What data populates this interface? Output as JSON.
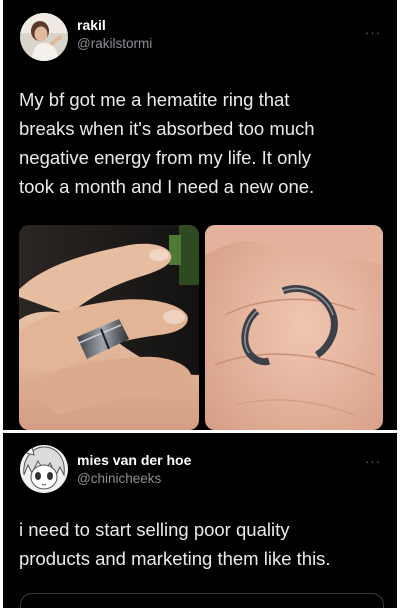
{
  "tweets": [
    {
      "display_name": "rakil",
      "handle": "@rakilstormi",
      "more_label": "···",
      "avatar_icon": "user-photo-avatar",
      "lines": [
        "My bf got me a hematite ring that",
        "breaks when it's absorbed too much",
        "negative energy from my life. It only",
        "took a month and I need a new one."
      ],
      "media": [
        "hand-with-ring-photo",
        "broken-ring-in-palm-photo"
      ]
    },
    {
      "display_name": "mies van der hoe",
      "handle": "@chinicheeks",
      "more_label": "···",
      "avatar_icon": "anime-avatar",
      "lines": [
        "i need to start selling poor quality",
        "products and marketing them like this."
      ]
    }
  ],
  "colors": {
    "background": "#000000",
    "text": "#e8eaec",
    "handle": "#8b8f94",
    "page": "#ffffff"
  }
}
